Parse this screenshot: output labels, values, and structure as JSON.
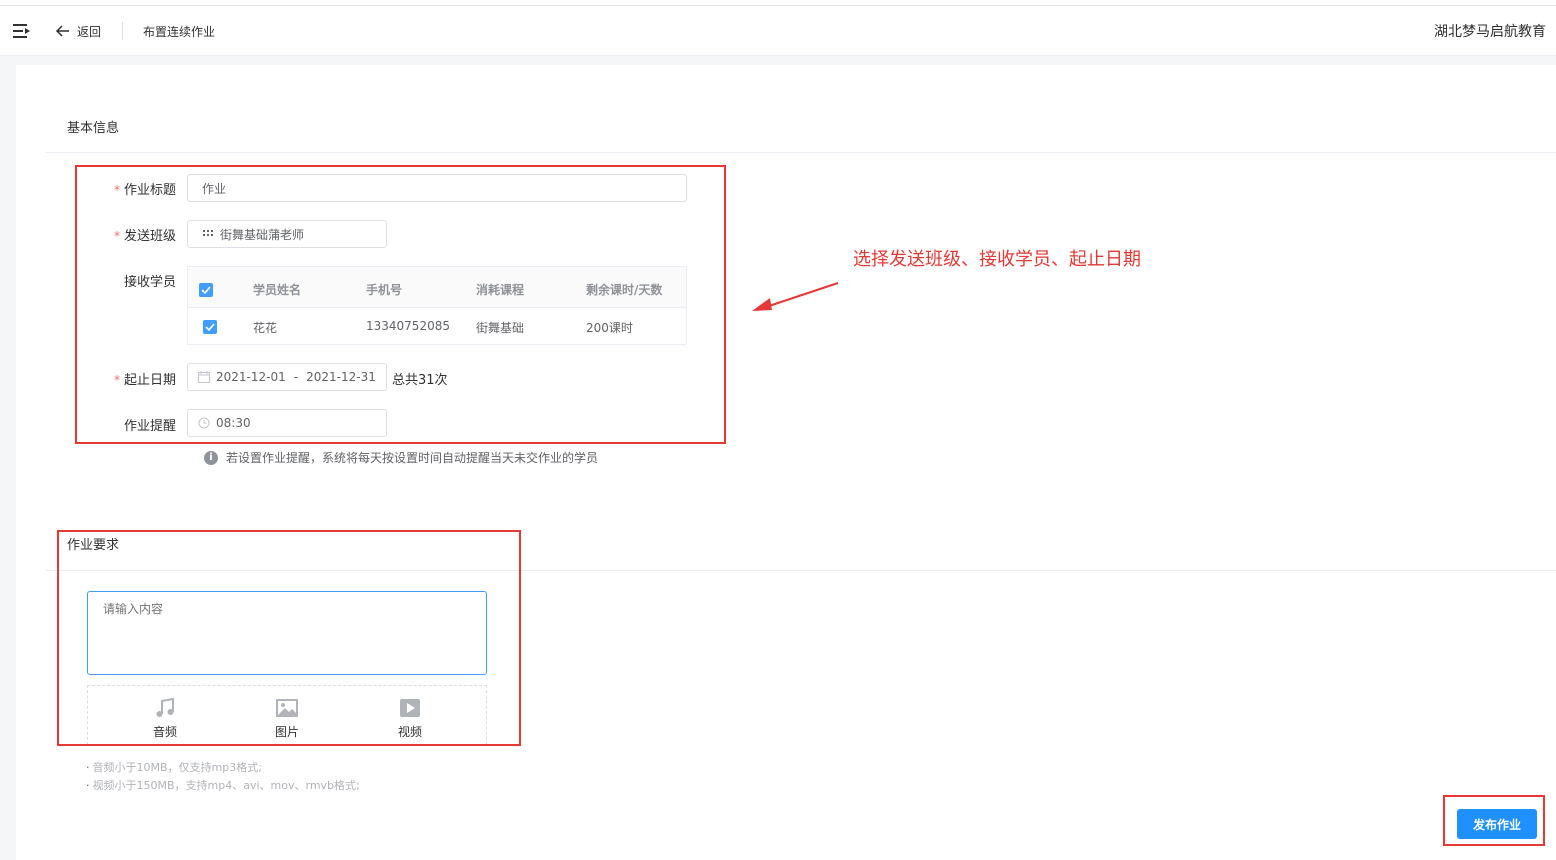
{
  "header": {
    "back_label": "返回",
    "page_title": "布置连续作业",
    "org_name": "湖北梦马启航教育"
  },
  "basic": {
    "section_title": "基本信息",
    "title_label": "作业标题",
    "title_value": "作业",
    "class_label": "发送班级",
    "class_value": "街舞基础蒲老师",
    "students_label": "接收学员",
    "table": {
      "columns": [
        "学员姓名",
        "手机号",
        "消耗课程",
        "剩余课时/天数"
      ],
      "rows": [
        {
          "name": "花花",
          "phone": "13340752085",
          "course": "街舞基础",
          "remaining": "200课时",
          "checked": true
        }
      ]
    },
    "date_label": "起止日期",
    "date_start": "2021-12-01",
    "date_sep": "-",
    "date_end": "2021-12-31",
    "date_total": "总共31次",
    "reminder_label": "作业提醒",
    "reminder_value": "08:30",
    "reminder_hint": "若设置作业提醒，系统将每天按设置时间自动提醒当天未交作业的学员"
  },
  "requirement": {
    "section_title": "作业要求",
    "placeholder": "请输入内容",
    "upload": [
      {
        "label": "音频",
        "icon": "music-icon"
      },
      {
        "label": "图片",
        "icon": "image-icon"
      },
      {
        "label": "视频",
        "icon": "video-icon"
      }
    ],
    "notes": [
      "音频小于10MB，仅支持mp3格式;",
      "视频小于150MB，支持mp4、avi、mov、rmvb格式;"
    ],
    "note_bullet": "·"
  },
  "actions": {
    "publish_label": "发布作业"
  },
  "annotation": {
    "text": "选择发送班级、接收学员、起止日期"
  },
  "colors": {
    "primary": "#1e90ff",
    "annotation": "#e53935",
    "required": "#f56c6c"
  }
}
